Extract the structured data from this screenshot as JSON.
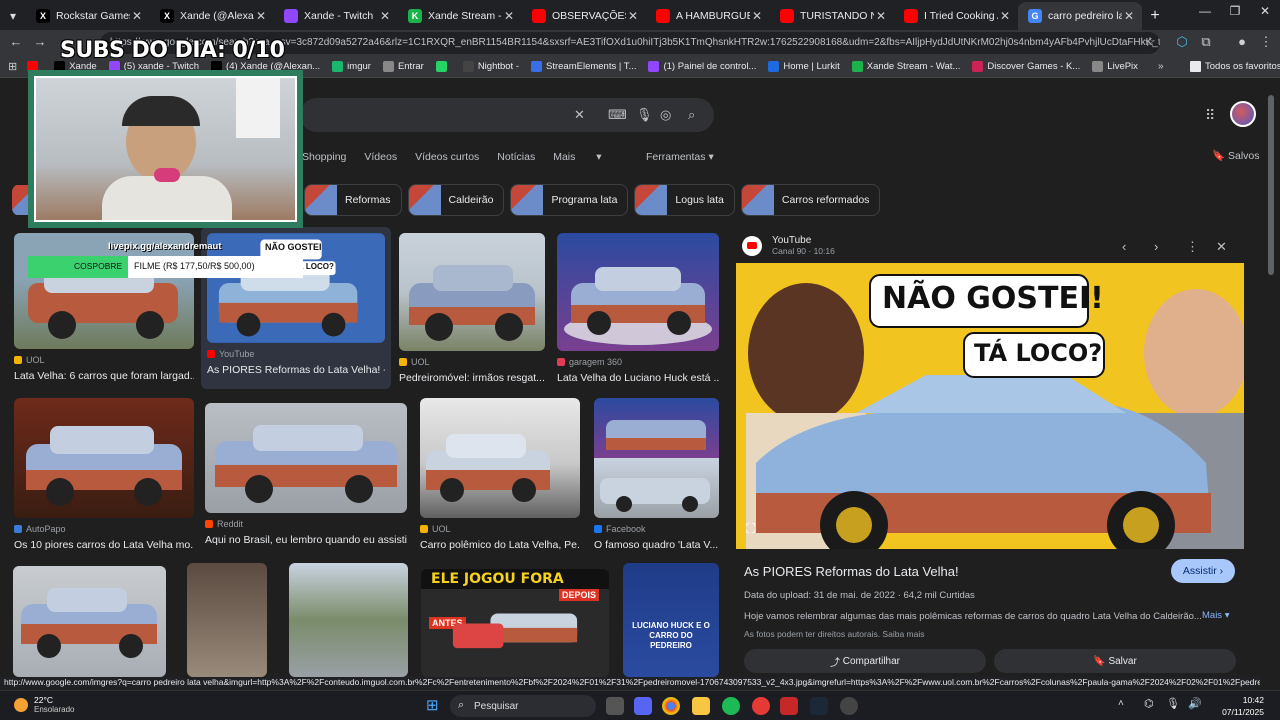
{
  "tabs": [
    {
      "title": "Rockstar Games (@R",
      "fav_color": "#000000",
      "fav_char": "X"
    },
    {
      "title": "Xande (@AlexandreM",
      "fav_color": "#000000",
      "fav_char": "X"
    },
    {
      "title": "Xande - Twitch",
      "fav_color": "#9146ff",
      "fav_char": ""
    },
    {
      "title": "Xande Stream - Wat",
      "fav_color": "#1bb24b",
      "fav_char": "K"
    },
    {
      "title": "OBSERVAÇÕES DIÁRI",
      "fav_color": "#ff0000",
      "fav_char": ""
    },
    {
      "title": "A HAMBURGUERIA D",
      "fav_color": "#ff0000",
      "fav_char": ""
    },
    {
      "title": "TURISTANDO NA CA",
      "fav_color": "#ff0000",
      "fav_char": ""
    },
    {
      "title": "I Tried Cooking A5 W",
      "fav_color": "#ff0000",
      "fav_char": ""
    },
    {
      "title": "carro pedreiro lata ve",
      "fav_color": "#4285f4",
      "fav_char": "G",
      "active": true
    }
  ],
  "address": "https://www.google.com/search?sca_esv=3c872d09a5272a46&rlz=1C1RXQR_enBR1154BR1154&sxsrf=AE3TifOXd1u0hiITj3b5K1TmQhsnkHTR2w:1762522908168&udm=2&fbs=AIljpHydJdUtNKrM02hj0s4nbm4yAFb4PvhjlUcDtaFHkK_tyqfYVx0lCBcCX38sg5L...",
  "bookmarks": [
    {
      "label": "",
      "color": "#ff0000"
    },
    {
      "label": "Xande",
      "color": "#000000"
    },
    {
      "label": "(5) xande - Twitch",
      "color": "#9146ff"
    },
    {
      "label": "(4) Xande (@Alexan...",
      "color": "#000000"
    },
    {
      "label": "imgur",
      "color": "#1bb76e"
    },
    {
      "label": "Entrar",
      "color": "#888888"
    },
    {
      "label": "",
      "color": "#25d366"
    },
    {
      "label": "Nightbot -",
      "color": "#444444"
    },
    {
      "label": "StreamElements | T...",
      "color": "#3a6ee8"
    },
    {
      "label": "(1) Painel de control...",
      "color": "#9146ff"
    },
    {
      "label": "Home | Lurkit",
      "color": "#1e6ae1"
    },
    {
      "label": "Xande Stream - Wat...",
      "color": "#1bb24b"
    },
    {
      "label": "Discover Games - K...",
      "color": "#cc2255"
    },
    {
      "label": "LivePix",
      "color": "#888888"
    }
  ],
  "bookmarks_other": "Todos os favoritos",
  "filters": [
    "Shopping",
    "Vídeos",
    "Vídeos curtos",
    "Notícias",
    "Mais"
  ],
  "tools_label": "Ferramentas",
  "saved_label": "Salvos",
  "chips": [
    "Reformas",
    "Caldeirão",
    "Programa lata",
    "Logus lata",
    "Carros reformados"
  ],
  "results": [
    {
      "source": "UOL",
      "caption": "Lata Velha: 6 carros que foram largad...",
      "dot": "#f4b400"
    },
    {
      "source": "YouTube",
      "caption": "As PIORES Reformas do Lata Velha! -...",
      "dot": "#ff0000"
    },
    {
      "source": "UOL",
      "caption": "Pedreiromóvel: irmãos resgat...",
      "dot": "#f4b400"
    },
    {
      "source": "garagem 360",
      "caption": "Lata Velha do Luciano Huck está ...",
      "dot": "#e23b55"
    },
    {
      "source": "AutoPapo",
      "caption": "Os 10 piores carros do Lata Velha mo...",
      "dot": "#3a7bd5"
    },
    {
      "source": "Reddit",
      "caption": "Aqui no Brasil, eu lembro quando eu assisti...",
      "dot": "#ff4500"
    },
    {
      "source": "UOL",
      "caption": "Carro polêmico do Lata Velha, Pe...",
      "dot": "#f4b400"
    },
    {
      "source": "Facebook",
      "caption": "O famoso quadro 'Lata V...",
      "dot": "#1877f2"
    }
  ],
  "thumb_texts": {
    "nao_gostei": "NÃO GOSTEI",
    "ta_loco": "TÁ LOCO?",
    "jogou_fora": "ELE JOGOU FORA",
    "depois": "DEPOIS",
    "antes": "ANTES",
    "luciano": "LUCIANO HUCK E O CARRO DO PEDREIRO"
  },
  "panel": {
    "source": "YouTube",
    "subtitle": "Canal 90 · 10:16",
    "bubble1": "NÃO GOSTEI!",
    "bubble2": "TÁ LOCO?",
    "title": "As PIORES Reformas do Lata Velha!",
    "watch": "Assistir",
    "date": "Data do upload: 31 de mai. de 2022 · 64,2 mil Curtidas",
    "description": "Hoje vamos relembrar algumas das mais polêmicas reformas de carros do quadro Lata Velha do Caldeirão...",
    "more": "Mais",
    "rights": "As fotos podem ter direitos autorais. Saiba mais",
    "share": "Compartilhar",
    "save": "Salvar"
  },
  "status_url": "http://www.google.com/imgres?q=carro pedreiro lata velha&imgurl=http%3A%2F%2Fconteudo.imguol.com.br%2Fc%2Fentretenimento%2Fbf%2F2024%2F01%2F31%2Fpedreiromovel-1706743097533_v2_4x3.jpg&imgrefurl=https%3A%2F%2Fwww.uol.com.br%2Fcarros%2Fcolunas%2Fpaula-gama%2F2024%2F02%2F01%2Fpedreiromovel-irmaos-resgat...",
  "taskbar": {
    "temp": "22°C",
    "condition": "Ensolarado",
    "search": "Pesquisar",
    "time": "10:42",
    "date": "07/11/2025"
  },
  "overlay": {
    "subs": "SUBS DO DIA: 0/10",
    "livepix_url": "livepix.gg/alexandremaut",
    "livepix_label": "COSPOBRE",
    "livepix_goal": "FILME (R$ 177,50/R$ 500,00)"
  }
}
